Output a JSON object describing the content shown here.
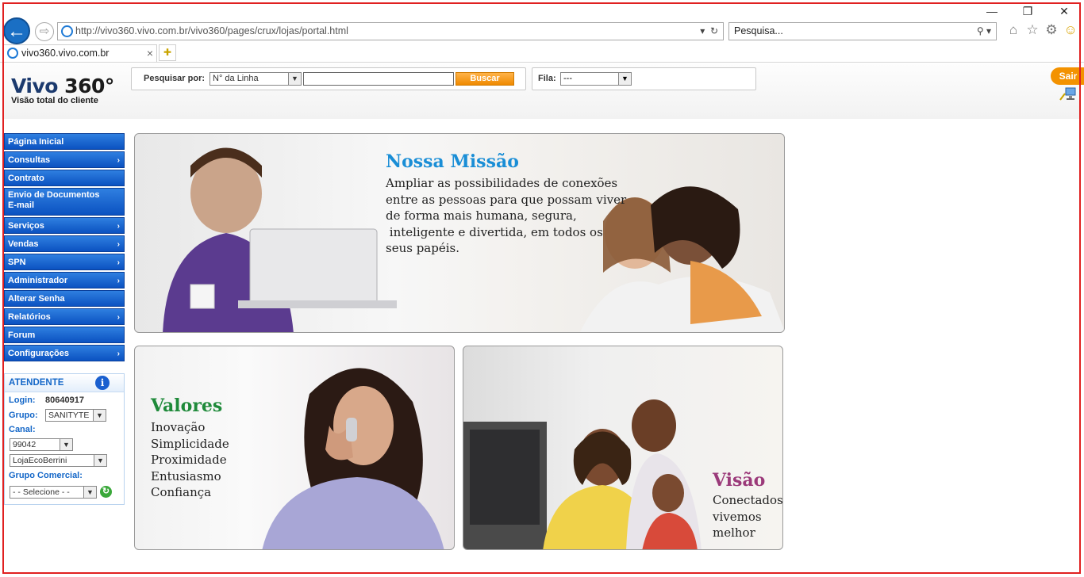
{
  "browser": {
    "url": "http://vivo360.vivo.com.br/vivo360/pages/crux/lojas/portal.html",
    "search_placeholder": "Pesquisa...",
    "tab_title": "vivo360.vivo.com.br",
    "tab_close": "×",
    "window_controls": [
      "—",
      "❐",
      "✕"
    ],
    "toolbar_icons": [
      "home-icon",
      "star-icon",
      "gear-icon",
      "smiley-icon"
    ]
  },
  "header": {
    "logo_name": "Vivo",
    "logo_number": "360°",
    "logo_subtitle": "Visão total do cliente",
    "search_label": "Pesquisar por:",
    "search_type": "N° da Linha",
    "search_button": "Buscar",
    "fila_label": "Fila:",
    "fila_value": "---",
    "logout": "Sair"
  },
  "menu": {
    "items": [
      {
        "label": "Página Inicial",
        "arrow": ""
      },
      {
        "label": "Consultas",
        "arrow": "›"
      },
      {
        "label": "Contrato",
        "arrow": ""
      },
      {
        "label": "Envio de Documentos\nE-mail",
        "arrow": ""
      },
      {
        "label": "Serviços",
        "arrow": "›"
      },
      {
        "label": "Vendas",
        "arrow": "›"
      },
      {
        "label": "SPN",
        "arrow": "›"
      },
      {
        "label": "Administrador",
        "arrow": "›"
      },
      {
        "label": "Alterar Senha",
        "arrow": ""
      },
      {
        "label": "Relatórios",
        "arrow": "›"
      },
      {
        "label": "Forum",
        "arrow": ""
      },
      {
        "label": "Configurações",
        "arrow": "›"
      }
    ]
  },
  "attendant": {
    "title": "ATENDENTE",
    "login_label": "Login:",
    "login_value": "80640917",
    "grupo_label": "Grupo:",
    "grupo_value": "SANITYTE",
    "canal_label": "Canal:",
    "canal_value": "99042",
    "loja_value": "LojaEcoBerrini",
    "grupo_comercial_label": "Grupo Comercial:",
    "grupo_comercial_value": "- - Selecione - -"
  },
  "banners": {
    "mission": {
      "title": "Nossa Missão",
      "text": "Ampliar as possibilidades de conexões\nentre as pessoas para que possam viver\nde forma mais humana, segura,\n inteligente e divertida, em todos os\nseus papéis."
    },
    "values": {
      "title": "Valores",
      "text": "Inovação\nSimplicidade\nProximidade\nEntusiasmo\nConfiança"
    },
    "vision": {
      "title": "Visão",
      "text": "Conectados\nvivemos\nmelhor"
    }
  },
  "colors": {
    "brand_blue": "#1c3a6e",
    "menu_blue": "#0b52c1",
    "orange": "#f39200",
    "mission_title": "#1a8ed6",
    "values_title": "#1f8a3a",
    "vision_title": "#9b3a7a"
  }
}
